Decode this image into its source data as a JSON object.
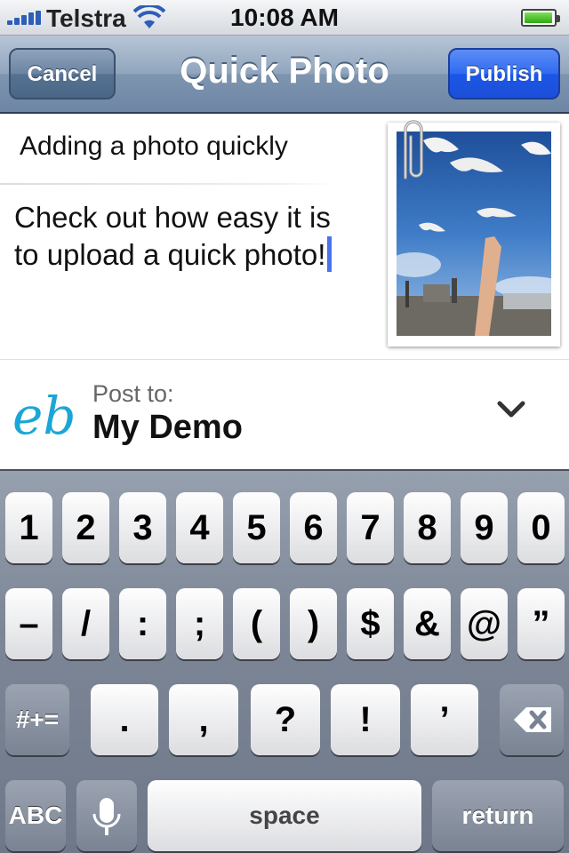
{
  "status_bar": {
    "carrier": "Telstra",
    "time": "10:08 AM",
    "battery_level": 0.9,
    "signal_bars": 5
  },
  "nav": {
    "title": "Quick Photo",
    "cancel_label": "Cancel",
    "publish_label": "Publish"
  },
  "post": {
    "title": "Adding a photo quickly",
    "body": "Check out how easy it is to upload a quick photo!"
  },
  "post_to": {
    "label": "Post to:",
    "blog": "My Demo",
    "logo_text": "eb"
  },
  "keyboard": {
    "row1": [
      "1",
      "2",
      "3",
      "4",
      "5",
      "6",
      "7",
      "8",
      "9",
      "0"
    ],
    "row2": [
      "–",
      "/",
      ":",
      ";",
      "(",
      ")",
      "$",
      "&",
      "@",
      "”"
    ],
    "row3": [
      ".",
      ",",
      "?",
      "!",
      "’"
    ],
    "mode_key": "#+=",
    "abc_key": "ABC",
    "space_key": "space",
    "return_key": "return"
  },
  "icons": {
    "signal": "signal-bars-icon",
    "wifi": "wifi-icon",
    "battery": "battery-icon",
    "mic": "microphone-icon",
    "delete": "backspace-icon",
    "chevron": "chevron-down-icon"
  },
  "colors": {
    "nav": "#7e95b0",
    "publish": "#2f6af0",
    "accent_logo": "#1aa6d6",
    "cursor": "#4a73e8"
  }
}
